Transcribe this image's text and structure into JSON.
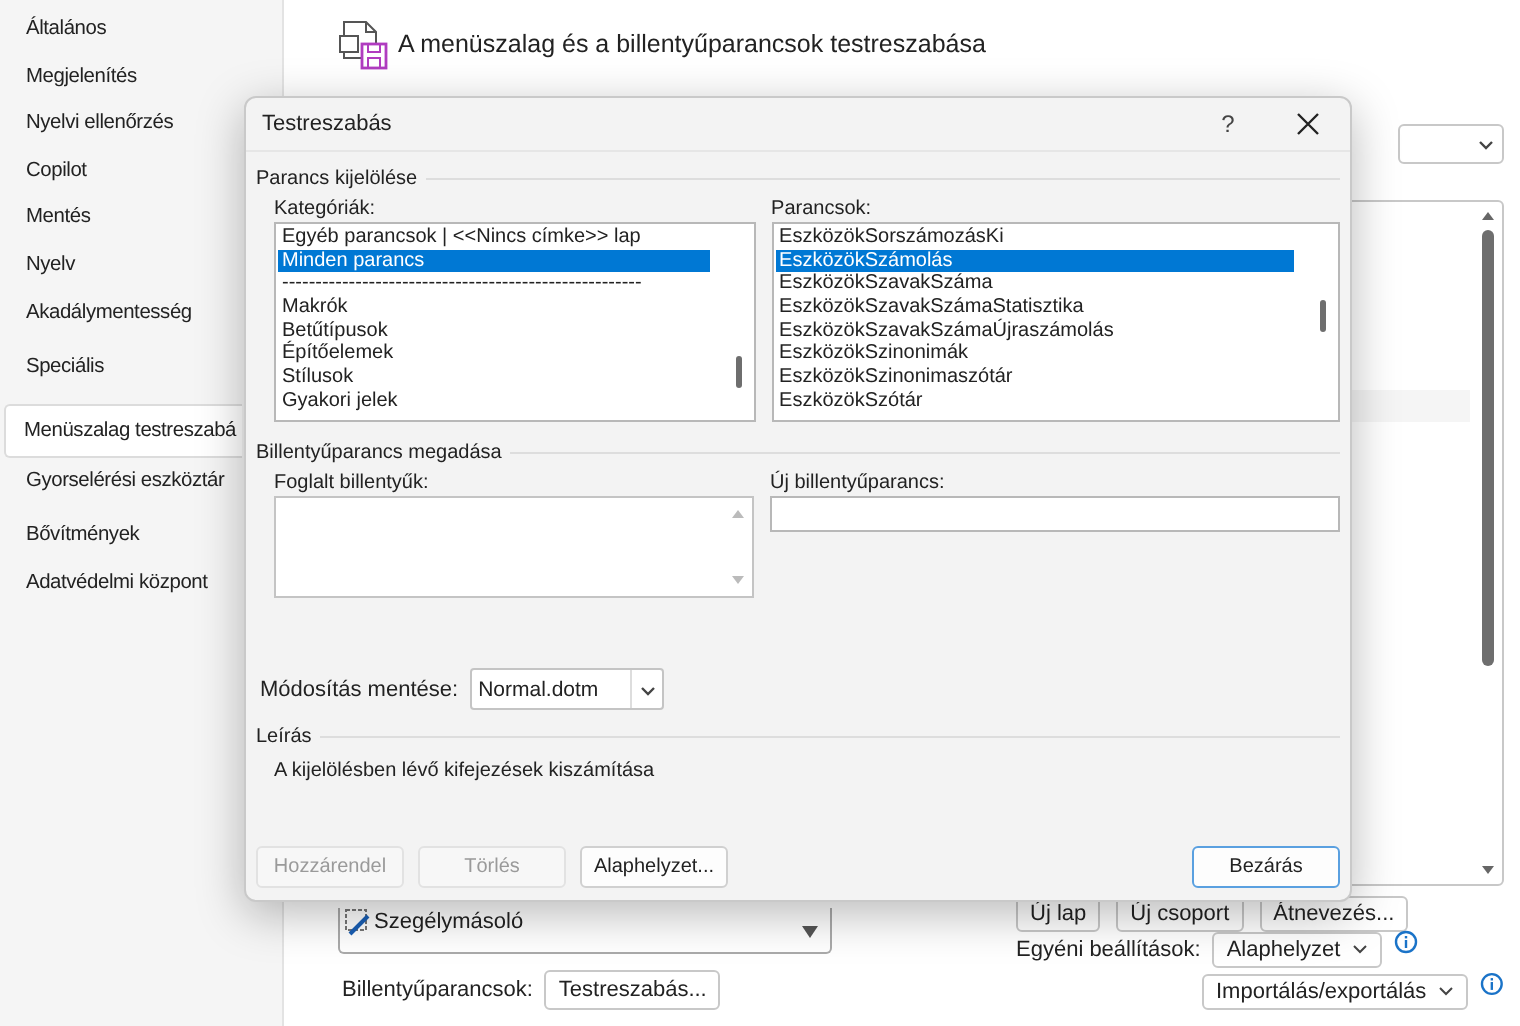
{
  "sidebar": {
    "items": [
      {
        "label": "Általános",
        "selected": false
      },
      {
        "label": "Megjelenítés",
        "selected": false
      },
      {
        "label": "Nyelvi ellenőrzés",
        "selected": false
      },
      {
        "label": "Copilot",
        "selected": false
      },
      {
        "label": "Mentés",
        "selected": false
      },
      {
        "label": "Nyelv",
        "selected": false
      },
      {
        "label": "Akadálymentesség",
        "selected": false
      },
      {
        "label": "Speciális",
        "selected": false
      },
      {
        "label": "Menüszalag testreszabá",
        "selected": true
      },
      {
        "label": "Gyorselérési eszköztár",
        "selected": false
      },
      {
        "label": "Bővítmények",
        "selected": false
      },
      {
        "label": "Adatvédelmi központ",
        "selected": false
      }
    ]
  },
  "main": {
    "title": "A menüszalag és a billentyűparancsok testreszabása",
    "left_list": {
      "items": [
        "Szegélymásoló"
      ]
    },
    "shortcuts_label": "Billentyűparancsok:",
    "shortcuts_button": "Testreszabás...",
    "tab_buttons": [
      "Új lap",
      "Új csoport",
      "Átnevezés..."
    ],
    "custom_label": "Egyéni beállítások:",
    "reset_button": "Alaphelyzet",
    "import_export_button": "Importálás/exportálás"
  },
  "dialog": {
    "title": "Testreszabás",
    "help": "?",
    "command_section": "Parancs kijelölése",
    "categories": {
      "label": "Kategóriák:",
      "items": [
        {
          "text": "Egyéb parancsok | <<Nincs címke>> lap",
          "selected": false
        },
        {
          "text": "Minden parancs",
          "selected": true
        },
        {
          "text": "------------------------------------------------------",
          "selected": false
        },
        {
          "text": "Makrók",
          "selected": false
        },
        {
          "text": "Betűtípusok",
          "selected": false
        },
        {
          "text": "Építőelemek",
          "selected": false
        },
        {
          "text": "Stílusok",
          "selected": false
        },
        {
          "text": "Gyakori jelek",
          "selected": false
        }
      ]
    },
    "commands": {
      "label": "Parancsok:",
      "items": [
        {
          "text": "EszközökSorszámozásKi",
          "selected": false
        },
        {
          "text": "EszközökSzámolás",
          "selected": true
        },
        {
          "text": "EszközökSzavakSzáma",
          "selected": false
        },
        {
          "text": "EszközökSzavakSzámaStatisztika",
          "selected": false
        },
        {
          "text": "EszközökSzavakSzámaÚjraszámolás",
          "selected": false
        },
        {
          "text": "EszközökSzinonimák",
          "selected": false
        },
        {
          "text": "EszközökSzinonimaszótár",
          "selected": false
        },
        {
          "text": "EszközökSzótár",
          "selected": false
        }
      ]
    },
    "shortcut_section": "Billentyűparancs megadása",
    "current_keys_label": "Foglalt billentyűk:",
    "new_shortcut_label": "Új billentyűparancs:",
    "save_in": {
      "label": "Módosítás mentése:",
      "value": "Normal.dotm"
    },
    "description_section": "Leírás",
    "description": "A kijelölésben lévő kifejezések kiszámítása",
    "buttons": [
      {
        "label": "Hozzárendel",
        "disabled": true,
        "default": false
      },
      {
        "label": "Törlés",
        "disabled": true,
        "default": false
      },
      {
        "label": "Alaphelyzet...",
        "disabled": false,
        "default": false
      }
    ],
    "close_button": {
      "label": "Bezárás",
      "disabled": false,
      "default": true
    }
  }
}
